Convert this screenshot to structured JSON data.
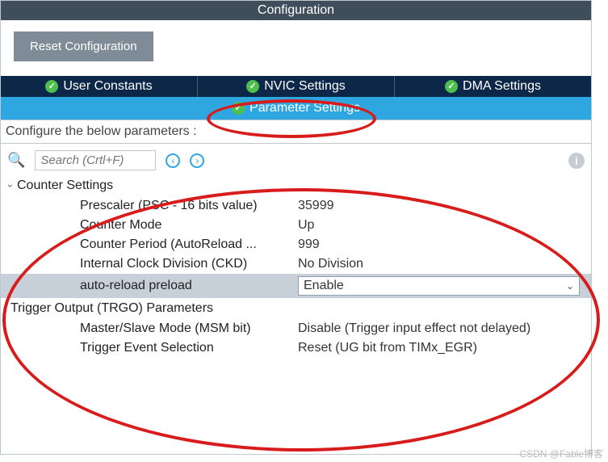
{
  "titlebar": "Configuration",
  "reset_button": "Reset Configuration",
  "tabs_row1": [
    {
      "label": "User Constants"
    },
    {
      "label": "NVIC Settings"
    },
    {
      "label": "DMA Settings"
    }
  ],
  "tabs_row2": {
    "label": "Parameter Settings"
  },
  "subtitle": "Configure the below parameters :",
  "search": {
    "placeholder": "Search (Crtl+F)"
  },
  "groups": {
    "counter": {
      "title": "Counter Settings",
      "rows": [
        {
          "label": "Prescaler (PSC - 16 bits value)",
          "value": "35999"
        },
        {
          "label": "Counter Mode",
          "value": "Up"
        },
        {
          "label": "Counter Period (AutoReload ...",
          "value": "999"
        },
        {
          "label": "Internal Clock Division (CKD)",
          "value": "No Division"
        },
        {
          "label": "auto-reload preload",
          "value": "Enable",
          "selected": true
        }
      ]
    },
    "trgo": {
      "title": "Trigger Output (TRGO) Parameters",
      "rows": [
        {
          "label": "Master/Slave Mode (MSM bit)",
          "value": "Disable (Trigger input effect not delayed)"
        },
        {
          "label": "Trigger Event Selection",
          "value": "Reset (UG bit from TIMx_EGR)"
        }
      ]
    }
  },
  "watermark": "CSDN @Fable博客"
}
